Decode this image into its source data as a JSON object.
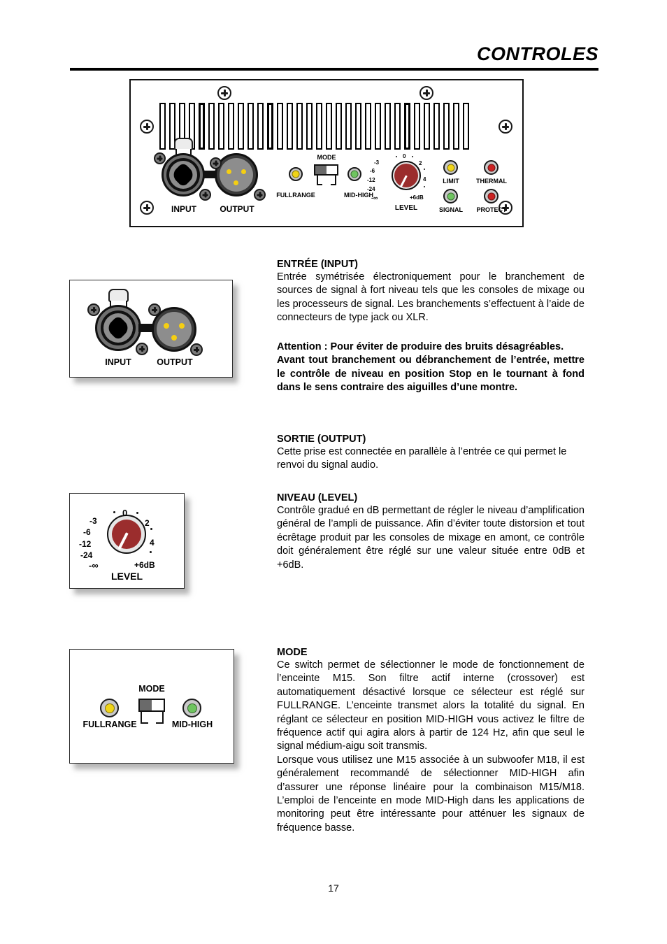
{
  "header": {
    "title": "CONTROLES"
  },
  "page_number": "17",
  "panel": {
    "connectors": {
      "input_label": "INPUT",
      "output_label": "OUTPUT"
    },
    "mode": {
      "caption": "MODE",
      "left_label": "FULLRANGE",
      "right_label": "MID-HIGH",
      "left_led_color": "#f0d417",
      "right_led_color": "#6ec45f",
      "selected": "FULLRANGE"
    },
    "level": {
      "caption": "LEVEL",
      "knob_color": "#9b2d2d",
      "ticks": [
        "-∞",
        "-24",
        "-12",
        "-6",
        "-3",
        "0",
        "2",
        "4",
        "+6dB"
      ]
    },
    "indicators": [
      {
        "label": "LIMIT",
        "color": "#f0d417"
      },
      {
        "label": "THERMAL",
        "color": "#cc2222"
      },
      {
        "label": "SIGNAL",
        "color": "#6ec45f"
      },
      {
        "label": "PROTECT",
        "color": "#cc2222"
      }
    ]
  },
  "figures": {
    "io": {
      "input_label": "INPUT",
      "output_label": "OUTPUT"
    },
    "level": {
      "caption": "LEVEL",
      "ticks": [
        "-∞",
        "-24",
        "-12",
        "-6",
        "-3",
        "0",
        "2",
        "4",
        "+6dB"
      ]
    },
    "mode": {
      "caption": "MODE",
      "left_label": "FULLRANGE",
      "right_label": "MID-HIGH"
    }
  },
  "sections": {
    "input": {
      "heading": "ENTRÉE (INPUT)",
      "body": "Entrée symétrisée électroniquement pour le branchement de sources de signal à fort niveau tels que les consoles de mixage ou les processeurs de signal. Les branchements s’effectuent à l’aide de connecteurs de type jack ou XLR."
    },
    "warning": {
      "line1": "Attention : Pour éviter de produire des bruits désagréables.",
      "line2": "Avant tout branchement ou débranchement de l’entrée, mettre le contrôle de niveau en position Stop en le tournant à fond dans le sens contraire des aiguilles d’une montre."
    },
    "output": {
      "heading": "SORTIE (OUTPUT)",
      "body": "Cette prise est connectée en parallèle à l’entrée ce qui permet le renvoi du signal audio."
    },
    "level": {
      "heading": "NIVEAU (LEVEL)",
      "body": "Contrôle gradué en dB permettant de régler le niveau d’amplification général de l’ampli de puissance. Afin d’éviter toute distorsion et tout écrêtage produit par les consoles de mixage en amont, ce contrôle doit généralement être réglé sur une valeur située entre 0dB et +6dB."
    },
    "mode": {
      "heading": "MODE",
      "body1": "Ce switch permet de sélectionner le mode de fonctionnement de l’enceinte M15. Son filtre actif interne (crossover) est automatiquement désactivé lorsque ce sélecteur est réglé sur FULLRANGE. L’enceinte transmet alors la totalité du signal. En réglant ce sélecteur en position MID-HIGH vous activez le filtre de fréquence actif qui agira alors à partir de 124 Hz, afin que seul le signal médium-aigu soit transmis.",
      "body2": "Lorsque vous utilisez une M15 associée à un subwoofer M18, il est généralement recommandé de sélectionner MID-HIGH afin d’assurer une réponse linéaire pour la combinaison M15/M18. L’emploi de l’enceinte en mode MID-High dans les applications de monitoring peut être intéressante pour atténuer les signaux de fréquence basse."
    }
  }
}
